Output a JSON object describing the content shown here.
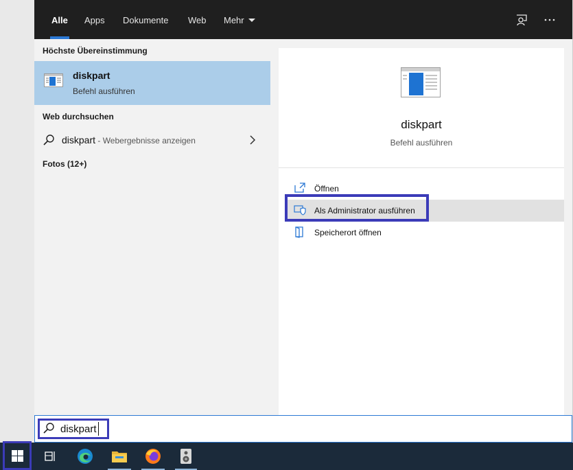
{
  "tabs": [
    {
      "label": "Alle",
      "active": true
    },
    {
      "label": "Apps"
    },
    {
      "label": "Dokumente"
    },
    {
      "label": "Web"
    },
    {
      "label": "Mehr"
    }
  ],
  "best_match": {
    "heading": "Höchste Übereinstimmung",
    "title": "diskpart",
    "subtitle": "Befehl ausführen"
  },
  "web": {
    "heading": "Web durchsuchen",
    "query": "diskpart",
    "suffix": " - Webergebnisse anzeigen"
  },
  "photos": {
    "heading": "Fotos (12+)"
  },
  "preview": {
    "title": "diskpart",
    "subtitle": "Befehl ausführen",
    "actions": [
      {
        "label": "Öffnen",
        "icon": "open-icon"
      },
      {
        "label": "Als Administrator ausführen",
        "icon": "shield-icon"
      },
      {
        "label": "Speicherort öffnen",
        "icon": "folder-location-icon"
      }
    ]
  },
  "search": {
    "value": "diskpart"
  },
  "colors": {
    "accent": "#2b78d4",
    "selection": "#abcde9",
    "annotation": "#3b3bb8",
    "taskbar": "#1b2a3a"
  },
  "taskbar": {
    "items": [
      "windows-start-icon",
      "task-view-icon",
      "edge-icon",
      "file-explorer-icon",
      "firefox-icon",
      "speaker-app-icon"
    ]
  }
}
